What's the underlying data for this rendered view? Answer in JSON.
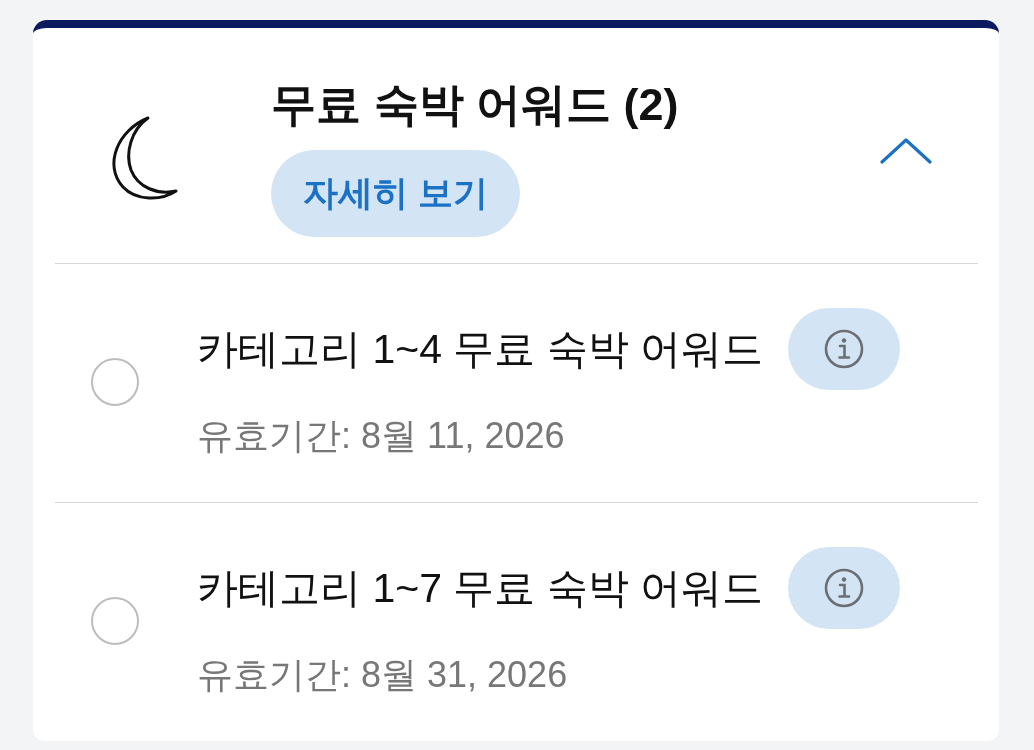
{
  "section": {
    "title": "무료 숙박 어워드 (2)",
    "details_button": "자세히 보기",
    "expanded": true
  },
  "awards": [
    {
      "title": "카테고리 1~4 무료 숙박 어워드",
      "validity": "유효기간: 8월 11, 2026",
      "selected": false
    },
    {
      "title": "카테고리 1~7 무료 숙박 어워드",
      "validity": "유효기간: 8월 31, 2026",
      "selected": false
    }
  ]
}
